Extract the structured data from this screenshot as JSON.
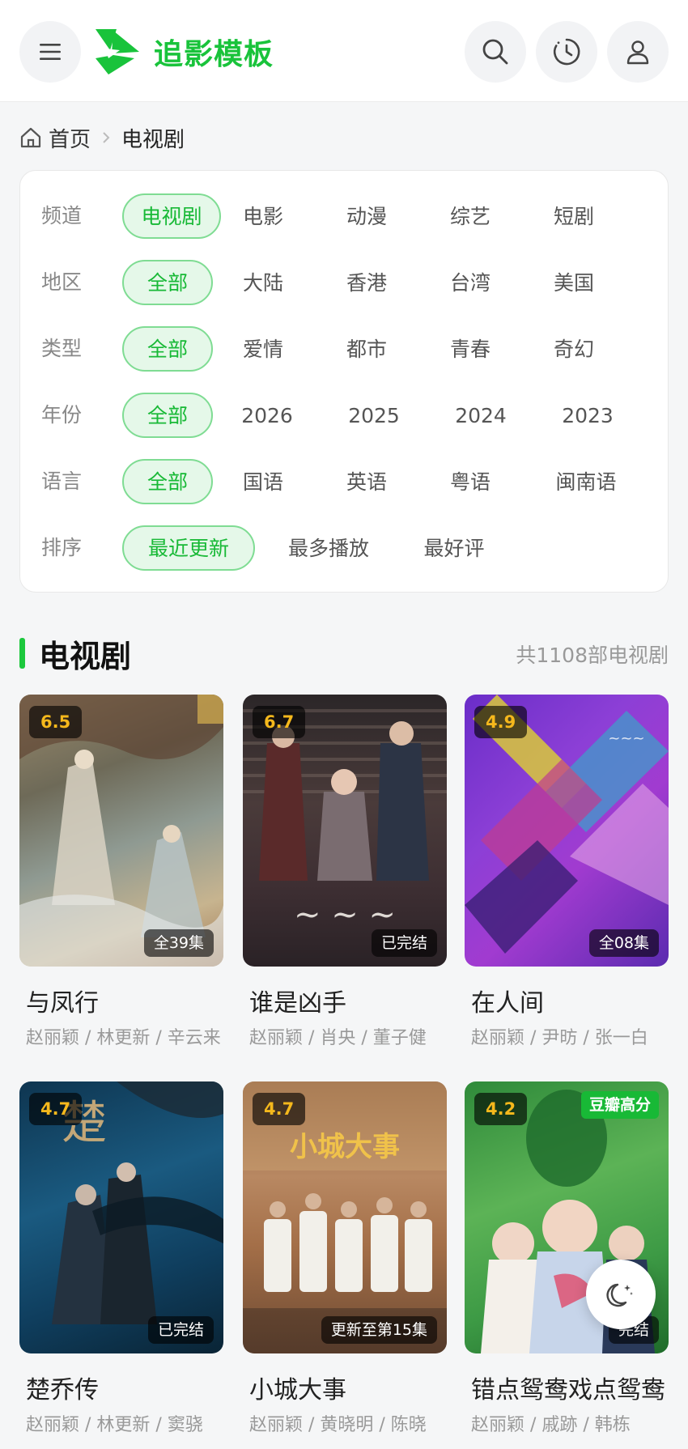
{
  "header": {
    "logo_text": "追影模板",
    "brand_color": "#19c33b",
    "icons": [
      "menu-icon",
      "search-icon",
      "history-icon",
      "user-icon"
    ]
  },
  "breadcrumb": {
    "home": "首页",
    "current": "电视剧"
  },
  "filters": [
    {
      "label": "频道",
      "options": [
        "电视剧",
        "电影",
        "动漫",
        "综艺",
        "短剧"
      ],
      "active": "电视剧"
    },
    {
      "label": "地区",
      "options": [
        "全部",
        "大陆",
        "香港",
        "台湾",
        "美国"
      ],
      "active": "全部"
    },
    {
      "label": "类型",
      "options": [
        "全部",
        "爱情",
        "都市",
        "青春",
        "奇幻"
      ],
      "active": "全部"
    },
    {
      "label": "年份",
      "options": [
        "全部",
        "2026",
        "2025",
        "2024",
        "2023"
      ],
      "active": "全部"
    },
    {
      "label": "语言",
      "options": [
        "全部",
        "国语",
        "英语",
        "粤语",
        "闽南语"
      ],
      "active": "全部"
    },
    {
      "label": "排序",
      "options": [
        "最近更新",
        "最多播放",
        "最好评"
      ],
      "active": "最近更新"
    }
  ],
  "section": {
    "title": "电视剧",
    "count": "共1108部电视剧"
  },
  "cards": [
    {
      "title": "与凤行",
      "actors": "赵丽颖 / 林更新 / 辛云来",
      "rating": "6.5",
      "status": "全39集",
      "tag": ""
    },
    {
      "title": "谁是凶手",
      "actors": "赵丽颖 / 肖央 / 董子健",
      "rating": "6.7",
      "status": "已完结",
      "tag": ""
    },
    {
      "title": "在人间",
      "actors": "赵丽颖 / 尹昉 / 张一白",
      "rating": "4.9",
      "status": "全08集",
      "tag": ""
    },
    {
      "title": "楚乔传",
      "actors": "赵丽颖 / 林更新 / 窦骁",
      "rating": "4.7",
      "status": "已完结",
      "tag": ""
    },
    {
      "title": "小城大事",
      "actors": "赵丽颖 / 黄晓明 / 陈晓",
      "rating": "4.7",
      "status": "更新至第15集",
      "tag": ""
    },
    {
      "title": "错点鸳鸯戏点鸳鸯",
      "actors": "赵丽颖 / 戚跡 / 韩栋",
      "rating": "4.2",
      "status": "完结",
      "tag": "豆瓣高分"
    }
  ],
  "colors": {
    "accent": "#19c33b",
    "rating": "#f5b81c",
    "chip_active_bg": "#e5f8e9"
  }
}
